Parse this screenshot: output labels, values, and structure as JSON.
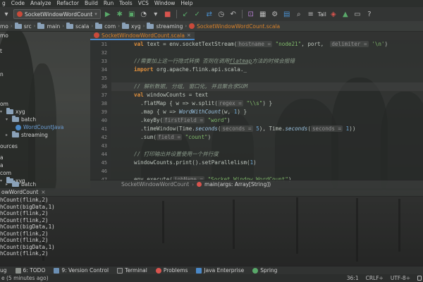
{
  "menu": {
    "items": [
      "g",
      "Code",
      "Analyze",
      "Refactor",
      "Build",
      "Run",
      "Tools",
      "VCS",
      "Window",
      "Help"
    ]
  },
  "toolbar": {
    "run_config": "SocketWindowWordCount",
    "tail_label": "Tail"
  },
  "breadcrumb": {
    "items": [
      "mo",
      "src",
      "main",
      "scala",
      "com",
      "xyg",
      "streaming"
    ],
    "file": "SocketWindowWordCount.scala"
  },
  "editor": {
    "tab_label": "SocketWindowWordCount.scala",
    "line_numbers": [
      "31",
      "32",
      "33",
      "34",
      "35",
      "36",
      "37",
      "38",
      "39",
      "40",
      "41",
      "42",
      "43",
      "44",
      "45",
      "46",
      "47"
    ],
    "code": {
      "l31_kw": "val",
      "l31_a": " text = env.socketTextStream(",
      "l31_h1": "hostname =",
      "l31_s1": " \"node21\"",
      "l31_b": ", port,  ",
      "l31_h2": "delimiter =",
      "l31_s2": " '\\n'",
      "l31_c": ")",
      "l33_cmt_a": "//需要加上这一行隐式转换 否则在调用",
      "l33_cmt_u": "flatmap",
      "l33_cmt_b": "方法的时候会报错",
      "l34_kw": "import",
      "l34_a": " org.apache.flink.api.scala._",
      "l36_cmt": "// 解析数据, 分组, 窗口化, 并且聚合求SUM",
      "l37_kw": "val",
      "l37_a": " windowCounts = text",
      "l38_a": "  .flatMap { w => w.split(",
      "l38_h": "regex =",
      "l38_s": " \"\\\\s\"",
      "l38_b": ") }",
      "l39_a": "  .map { w => ",
      "l39_it": "WordWithCount",
      "l39_b": "(w, ",
      "l39_n": "1",
      "l39_c": ") }",
      "l40_a": "  .keyBy(",
      "l40_h": "firstField =",
      "l40_s": " \"word\"",
      "l40_b": ")",
      "l41_a": "  .timeWindow(Time.",
      "l41_it1": "seconds",
      "l41_b": "(",
      "l41_h1": "seconds =",
      "l41_n1": " 5",
      "l41_c": "), Time.",
      "l41_it2": "seconds",
      "l41_d": "(",
      "l41_h2": "seconds =",
      "l41_n2": " 1",
      "l41_e": "))",
      "l42_a": "  .sum(",
      "l42_h": "field =",
      "l42_s": " \"count\"",
      "l42_b": ")",
      "l44_cmt": "// 打印输出并设置使用一个并行度",
      "l45_a": "windowCounts.print().setParallelism(",
      "l45_n": "1",
      "l45_b": ")",
      "l47_a": "env.execute(",
      "l47_h": "jobName =",
      "l47_s": " \"Socket Window WordCount\"",
      "l47_b": ")"
    },
    "status_class": "SocketWindowWordCount",
    "status_method": "main(args: Array[String])"
  },
  "tree": {
    "items": [
      {
        "label": "mo",
        "depth": 0
      },
      {
        "label": "",
        "depth": 0
      },
      {
        "label": "t",
        "depth": 0
      },
      {
        "label": "n",
        "depth": 0
      },
      {
        "label": "om",
        "depth": 0
      },
      {
        "label": "xyg",
        "depth": 1
      },
      {
        "label": "batch",
        "depth": 2
      },
      {
        "label": "WordCountJava",
        "depth": 3
      },
      {
        "label": "streaming",
        "depth": 2
      },
      {
        "label": "ources",
        "depth": 0
      },
      {
        "label": "a",
        "depth": 0
      },
      {
        "label": "a",
        "depth": 0
      },
      {
        "label": "com",
        "depth": 0
      },
      {
        "label": "xyg",
        "depth": 1
      },
      {
        "label": "batch",
        "depth": 2
      }
    ]
  },
  "run": {
    "title": "owWordCount",
    "lines": [
      "hCount(flink,2)",
      "hCount(bigData,1)",
      "hCount(flink,2)",
      "hCount(flink,2)",
      "hCount(bigData,1)",
      "hCount(flink,2)",
      "hCount(flink,2)",
      "hCount(bigData,1)",
      "hCount(flink,2)"
    ]
  },
  "tool_windows": [
    {
      "label": "ug",
      "icon": "bug-icon"
    },
    {
      "label": "6: TODO",
      "icon": "todo-icon"
    },
    {
      "label": "9: Version Control",
      "icon": "vcs-icon"
    },
    {
      "label": "Terminal",
      "icon": "terminal-icon"
    },
    {
      "label": "Problems",
      "icon": "problems-icon"
    },
    {
      "label": "Java Enterprise",
      "icon": "java-enterprise-icon"
    },
    {
      "label": "Spring",
      "icon": "spring-icon"
    }
  ],
  "statusbar": {
    "message": "e (5 minutes ago)",
    "position": "36:1",
    "line_sep": "CRLF÷",
    "encoding": "UTF-8÷"
  },
  "colors": {
    "keyword": "#e08f3c",
    "string": "#7fb86a",
    "accent": "#4a88c7",
    "file_tab": "#d9822b"
  }
}
